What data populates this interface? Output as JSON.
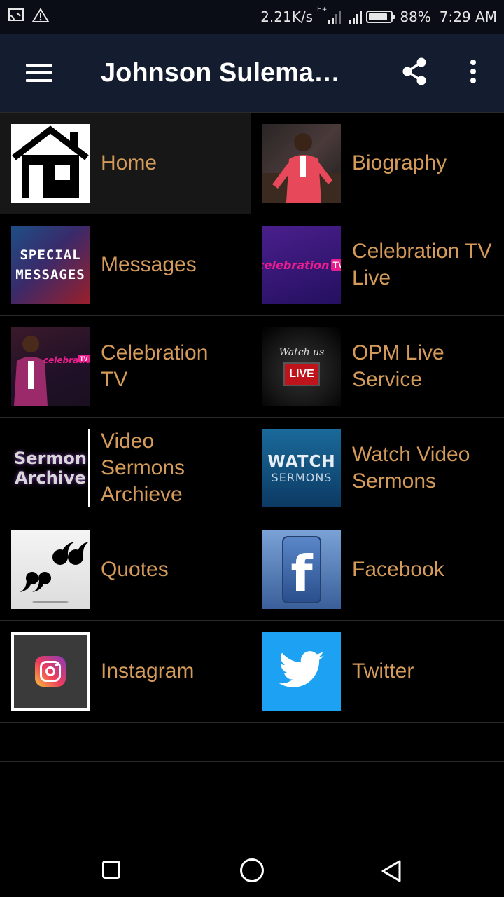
{
  "status_bar": {
    "speed": "2.21K/s",
    "network_type": "H+",
    "battery_percent": "88%",
    "battery_level": 0.88,
    "time": "7:29 AM",
    "icons": [
      "cast-icon",
      "warning-icon",
      "signal-icon",
      "battery-icon"
    ]
  },
  "app_bar": {
    "title": "Johnson Suleman Messages",
    "icons": [
      "menu-icon",
      "share-icon",
      "more-vert-icon"
    ]
  },
  "menu_tiles": [
    {
      "label": "Home",
      "icon": "home-icon"
    },
    {
      "label": "Biography",
      "icon": "biography-photo"
    },
    {
      "label": "Messages",
      "icon": "special-messages-thumbnail"
    },
    {
      "label": "Celebration TV Live",
      "icon": "celebration-tv-thumbnail"
    },
    {
      "label": "Celebration TV",
      "icon": "celebration-tv-thumbnail"
    },
    {
      "label": "OPM Live Service",
      "icon": "watch-live-thumbnail"
    },
    {
      "label": "Video Sermons Archieve",
      "icon": "sermon-archive-thumbnail"
    },
    {
      "label": "Watch Video Sermons",
      "icon": "watch-sermons-thumbnail"
    },
    {
      "label": "Quotes",
      "icon": "quotes-icon"
    },
    {
      "label": "Facebook",
      "icon": "facebook-icon"
    },
    {
      "label": "Instagram",
      "icon": "instagram-icon"
    },
    {
      "label": "Twitter",
      "icon": "twitter-icon"
    }
  ],
  "thumbnail_text": {
    "special": [
      "SPECIAL",
      "MESSAGES"
    ],
    "celebration": "celebration",
    "tv": "TV",
    "watch_us": "Watch us",
    "live": "LIVE",
    "sermon_archive": [
      "Sermon",
      "Archive"
    ],
    "watch_sermons": [
      "WATCH",
      "SERMONS"
    ],
    "facebook_letter": "f"
  },
  "colors": {
    "appbar": "#141c30",
    "statusbar": "#0a0d16",
    "label": "#d39a5a",
    "background": "#000000",
    "divider": "#2a2a2a"
  },
  "nav_bar": {
    "icons": [
      "recents-square-icon",
      "home-circle-icon",
      "back-triangle-icon"
    ]
  }
}
